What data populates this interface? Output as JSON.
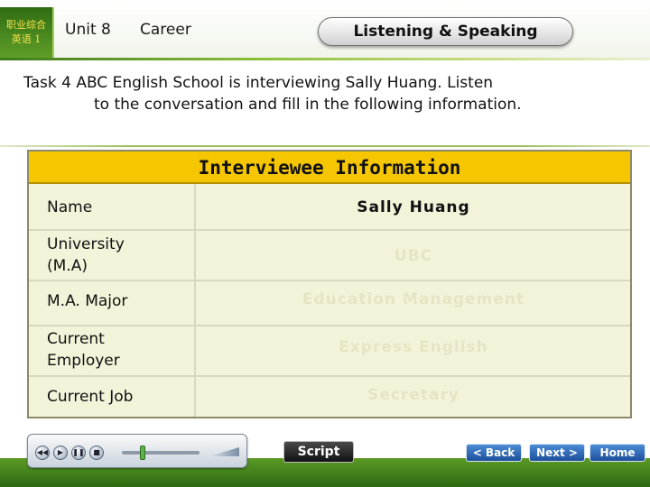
{
  "header": {
    "logo_line1": "职业综合",
    "logo_line2": "英语 1",
    "unit": "Unit 8",
    "topic": "Career",
    "section": "Listening & Speaking"
  },
  "task": {
    "line1": "Task 4 ABC English School is interviewing Sally Huang. Listen",
    "line2": "to the conversation and fill in the following information."
  },
  "table": {
    "title": "Interviewee Information",
    "rows": [
      {
        "label": "Name",
        "value": "Sally Huang"
      },
      {
        "label_line1": "University",
        "label_line2": "(M.A)",
        "value": "UBC"
      },
      {
        "label": "M.A. Major",
        "value": "Education Management"
      },
      {
        "label_line1": "Current",
        "label_line2": "Employer",
        "value": "Express English"
      },
      {
        "label": "Current Job",
        "value": "Secretary"
      }
    ]
  },
  "controls": {
    "script": "Script",
    "back": "< Back",
    "next": "Next >",
    "home": "Home"
  },
  "colors": {
    "title_bar": "#f6c600",
    "table_bg": "#f3f3da",
    "hidden_answer": "#e5e5c5",
    "brand_green": "#3d7a1c"
  }
}
